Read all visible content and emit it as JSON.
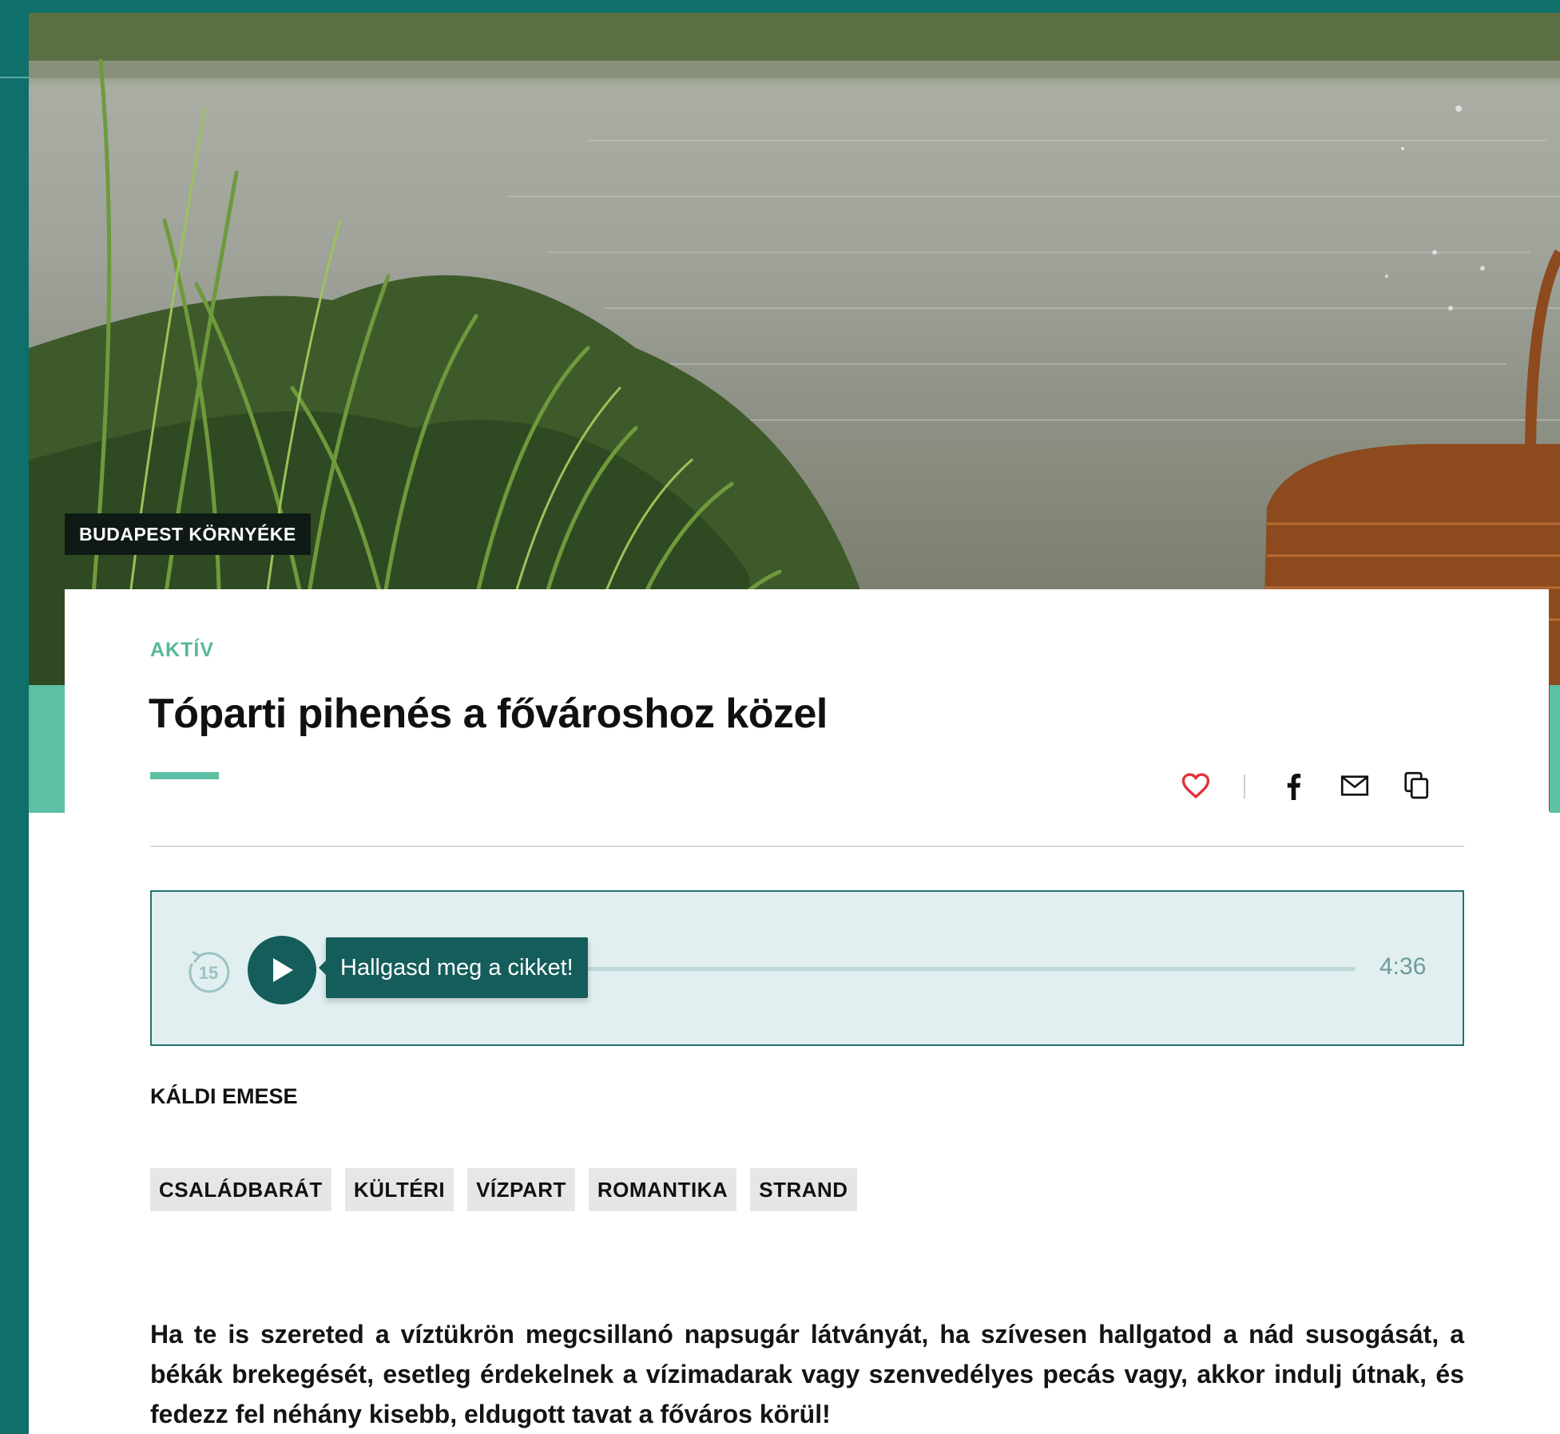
{
  "hero": {
    "region_badge": "BUDAPEST KÖRNYÉKE"
  },
  "article": {
    "category": "AKTÍV",
    "title": "Tóparti pihenés a fővároshoz közel",
    "author": "KÁLDI EMESE",
    "tags": [
      "CSALÁDBARÁT",
      "KÜLTÉRI",
      "VÍZPART",
      "ROMANTIKA",
      "STRAND"
    ],
    "lead": "Ha te is szereted a víztükrön megcsillanó napsugár látványát, ha szívesen hallgatod a nád susogását, a békák brekegését, esetleg érdekelnek a vízimadarak vagy szenvedélyes pecás vagy, akkor indulj útnak, és fedezz fel néhány kisebb, eldugott tavat a főváros körül!"
  },
  "share": {
    "icons": [
      "heart-icon",
      "facebook-icon",
      "mail-icon",
      "copy-icon"
    ]
  },
  "audio_player": {
    "rewind_label": "15",
    "cta": "Hallgasd meg a cikket!",
    "duration": "4:36",
    "progress": 0
  },
  "colors": {
    "brand_teal": "#0e6f6b",
    "accent_green": "#5bc0a4",
    "player_bg": "#e1eff0",
    "heart_red": "#e2333b"
  }
}
